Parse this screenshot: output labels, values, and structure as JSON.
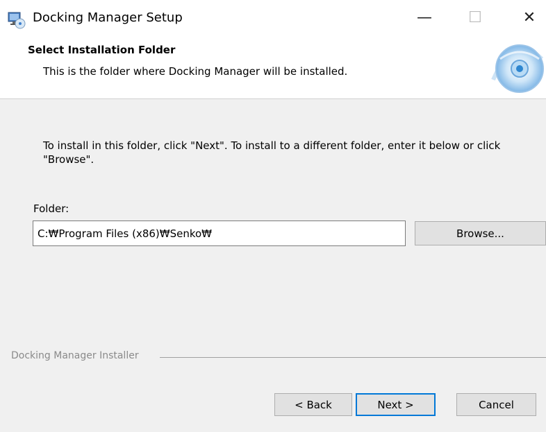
{
  "window": {
    "title": "Docking Manager Setup",
    "minimize_glyph": "—",
    "maximize_glyph": "☐",
    "close_glyph": "✕"
  },
  "header": {
    "title": "Select Installation Folder",
    "subtitle": "This is the folder where Docking Manager will be installed."
  },
  "body": {
    "instructions": "To install in this folder, click \"Next\". To install to a different folder, enter it below or click \"Browse\".",
    "folder_label": "Folder:",
    "folder_value": "C:₩Program Files (x86)₩Senko₩",
    "browse_label": "Browse..."
  },
  "footer": {
    "group_label": "Docking Manager Installer",
    "back_label": "< Back",
    "next_label": "Next >",
    "cancel_label": "Cancel"
  },
  "colors": {
    "focus_accent": "#0078d7",
    "button_face": "#e1e1e1",
    "dialog_background": "#f0f0f0"
  },
  "icons": {
    "app": "installer-computer-icon",
    "header_graphic": "disc-icon"
  }
}
